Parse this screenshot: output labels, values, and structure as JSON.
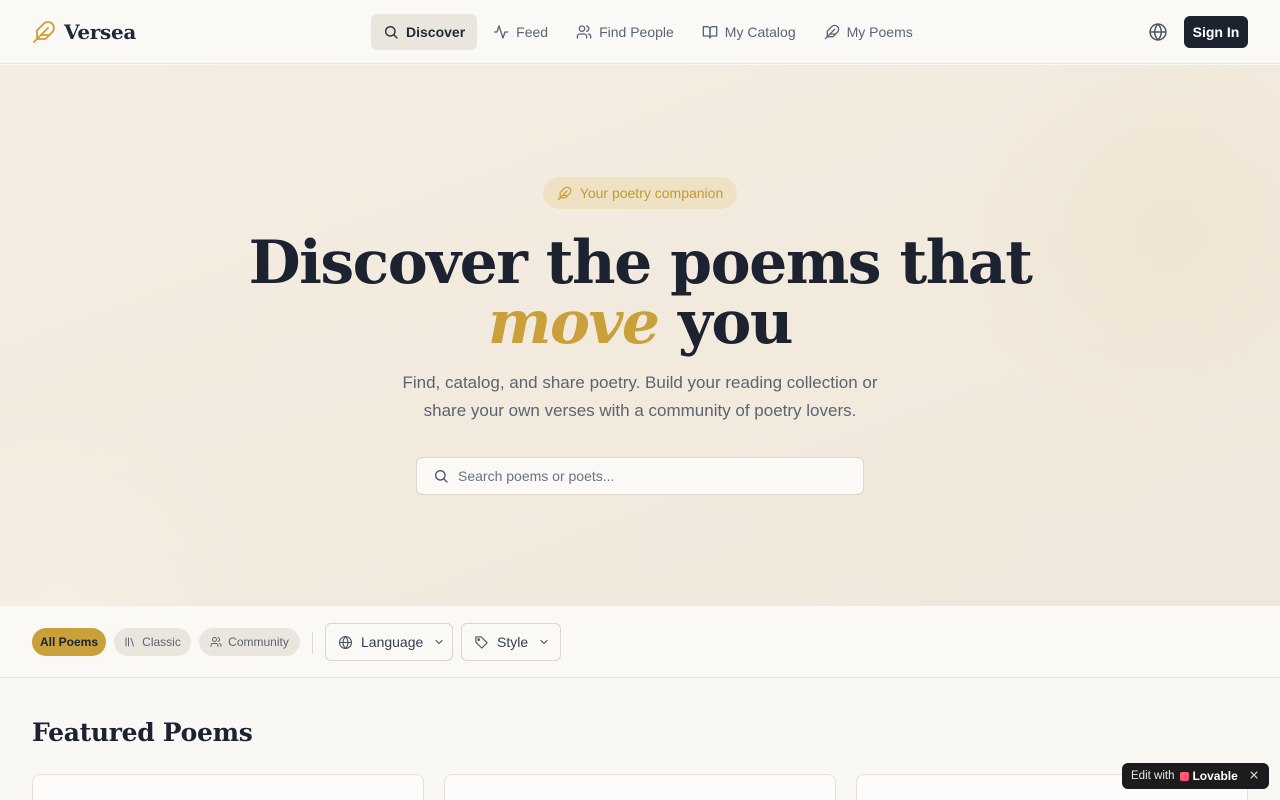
{
  "brand": {
    "name": "Versea",
    "icon": "feather-icon"
  },
  "nav": [
    {
      "label": "Discover",
      "icon": "search-icon",
      "active": true
    },
    {
      "label": "Feed",
      "icon": "activity-icon",
      "active": false
    },
    {
      "label": "Find People",
      "icon": "users-icon",
      "active": false
    },
    {
      "label": "My Catalog",
      "icon": "book-open-icon",
      "active": false
    },
    {
      "label": "My Poems",
      "icon": "feather-icon",
      "active": false
    }
  ],
  "header": {
    "language_icon": "globe-icon",
    "signin_label": "Sign In"
  },
  "hero": {
    "badge": "Your poetry companion",
    "headline_line1": "Discover the poems that",
    "headline_accent": "move",
    "headline_end": "you",
    "subtext": "Find, catalog, and share poetry. Build your reading collection or share your own verses with a community of poetry lovers.",
    "search_placeholder": "Search poems or poets..."
  },
  "filters": {
    "chips": [
      {
        "label": "All Poems",
        "active": true
      },
      {
        "label": "Classic",
        "active": false,
        "icon": "library-icon"
      },
      {
        "label": "Community",
        "active": false,
        "icon": "users-icon"
      }
    ],
    "language_label": "Language",
    "style_label": "Style"
  },
  "featured": {
    "title": "Featured Poems"
  },
  "lovable": {
    "prefix": "Edit with",
    "name": "Lovable"
  },
  "colors": {
    "accent": "#c9a03a",
    "dark": "#1c2230",
    "muted": "#5b6473",
    "hero_bg": "#f2eadd"
  }
}
